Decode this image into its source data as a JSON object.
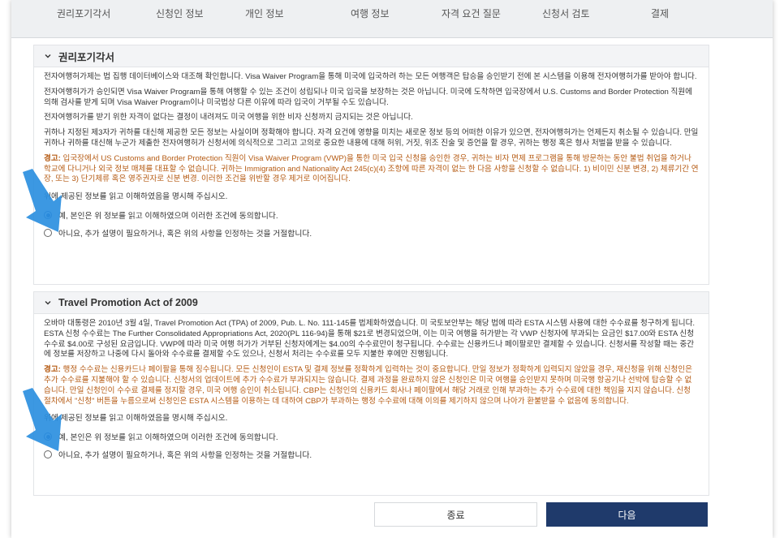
{
  "steps": [
    "권리포기각서",
    "신청인 정보",
    "개인 정보",
    "여행 정보",
    "자격 요건 질문",
    "신청서 검토",
    "결제"
  ],
  "waiver": {
    "title": "권리포기각서",
    "p1": "전자여행허가제는 법 집행 데이터베이스와 대조해 확인합니다. Visa Waiver Program을 통해 미국에 입국하려 하는 모든 여행객은 탑승을 승인받기 전에 본 시스템을 이용해 전자여행허가를 받아야 합니다.",
    "p2": "전자여행허가가 승인되면 Visa Waiver Program을 통해 여행할 수 있는 조건이 성립되나 미국 입국을 보장하는 것은 아닙니다. 미국에 도착하면 입국장에서 U.S. Customs and Border Protection 직원에 의해 검사를 받게 되며 Visa Waiver Program이나 미국법상 다른 이유에 따라 입국이 거부될 수도 있습니다.",
    "p3": "전자여행허가를 받기 위한 자격이 없다는 결정이 내려져도 미국 여행을 위한 비자 신청까지 금지되는 것은 아닙니다.",
    "p4": "귀하나 지정된 제3자가 귀하를 대신해 제공한 모든 정보는 사실이며 정확해야 합니다. 자격 요건에 영향을 미치는 새로운 정보 등의 어떠한 이유가 있으면, 전자여행허가는 언제든지 취소될 수 있습니다. 만일 귀하나 귀하를 대신해 누군가 제출한 전자여행허가 신청서에 의식적으로 그리고 고의로 중요한 내용에 대해 허위, 거짓, 위조 진술 및 증언을 할 경우, 귀하는 행정 혹은 형사 처벌을 받을 수 있습니다.",
    "warn_label": "경고:",
    "warn_text": " 입국장에서 US Customs and Border Protection 직원이 Visa Waiver Program (VWP)을 통한 미국 입국 신청을 승인한 경우, 귀하는 비자 면제 프로그램을 통해 방문하는 동안 불법 취업을 하거나 학교에 다니거나 외국 정보 매체를 대표할 수 없습니다. 귀하는 Immigration and Nationality Act 245(c)(4) 조항에 따른 자격이 없는 한 다음 사항을 신청할 수 없습니다. 1) 비이민 신분 변경, 2) 체류기간 연장, 또는 3) 단기체류 혹은 영주권자로 신분 변경. 이러한 조건을 위반할 경우 제거로 이어집니다.",
    "confirm": "위에 제공된 정보를 읽고 이해하였음을 명시해 주십시오.",
    "yes": "예, 본인은 위 정보를 읽고 이해하였으며 이러한 조건에 동의합니다.",
    "no": "아니요, 추가 설명이 필요하거나, 혹은 위의 사항을 인정하는 것을 거절합니다."
  },
  "travel": {
    "title": "Travel Promotion Act of 2009",
    "p1": "오바마 대통령은 2010년 3월 4일, Travel Promotion Act (TPA) of 2009, Pub. L. No. 111-145를 법제화하였습니다. 미 국토보안부는 해당 법에 따라 ESTA 시스템 사용에 대한 수수료를 청구하게 됩니다. ESTA 신청 수수료는 The Further Consolidated Appropriations Act, 2020(PL 116-94)을 통해 $21로 변경되었으며, 이는 미국 여행을 허가받는 각 VWP 신청자에 부과되는 요금인 $17.00와 ESTA 신청 수수료 $4.00로 구성된 요금입니다. VWP에 따라 미국 여행 허가가 거부된 신청자에게는 $4.00의 수수료만이 청구됩니다. 수수료는 신용카드나 페이팔로만 결제할 수 있습니다. 신청서를 작성할 때는 중간에 정보를 저장하고 나중에 다시 돌아와 수수료를 결제할 수도 있으나, 신청서 처리는 수수료를 모두 지불한 후에만 진행됩니다.",
    "warn_label": "경고:",
    "warn_text": " 행정 수수료는 신용카드나 페이팔을 통해 징수됩니다. 모든 신청인이 ESTA 및 결제 정보를 정확하게 입력하는 것이 중요합니다. 만일 정보가 정확하게 입력되지 않았을 경우, 재신청을 위해 신청인은 추가 수수료를 지불해야 할 수 있습니다. 신청서의 업데이트에 추가 수수료가 부과되지는 않습니다. 결제 과정을 완료하지 않은 신청인은 미국 여행을 승인받지 못하며 미국행 항공기나 선박에 탑승할 수 없습니다. 만일 신청인이 수수료 결제를 정지할 경우, 미국 여행 승인이 취소됩니다. CBP는 신청인의 신용카드 회사나 페이팔에서 해당 거래로 인해 부과하는 추가 수수료에 대한 책임을 지지 않습니다. 신청 절차에서 \"신청\" 버튼을 누름으로써 신청인은 ESTA 시스템을 이용하는 데 대하여 CBP가 부과하는 행정 수수료에 대해 이의를 제기하지 않으며 나아가 환불받을 수 없음에 동의합니다.",
    "confirm": "위에 제공된 정보를 읽고 이해하였음을 명시해 주십시오.",
    "yes": "예, 본인은 위 정보를 읽고 이해하였으며 이러한 조건에 동의합니다.",
    "no": "아니요, 추가 설명이 필요하거나, 혹은 위의 사항을 인정하는 것을 거절합니다."
  },
  "buttons": {
    "close": "종료",
    "next": "다음"
  },
  "colors": {
    "accent": "#1f3a6b",
    "warning": "#b55a12",
    "arrow": "#2b8fe0"
  }
}
